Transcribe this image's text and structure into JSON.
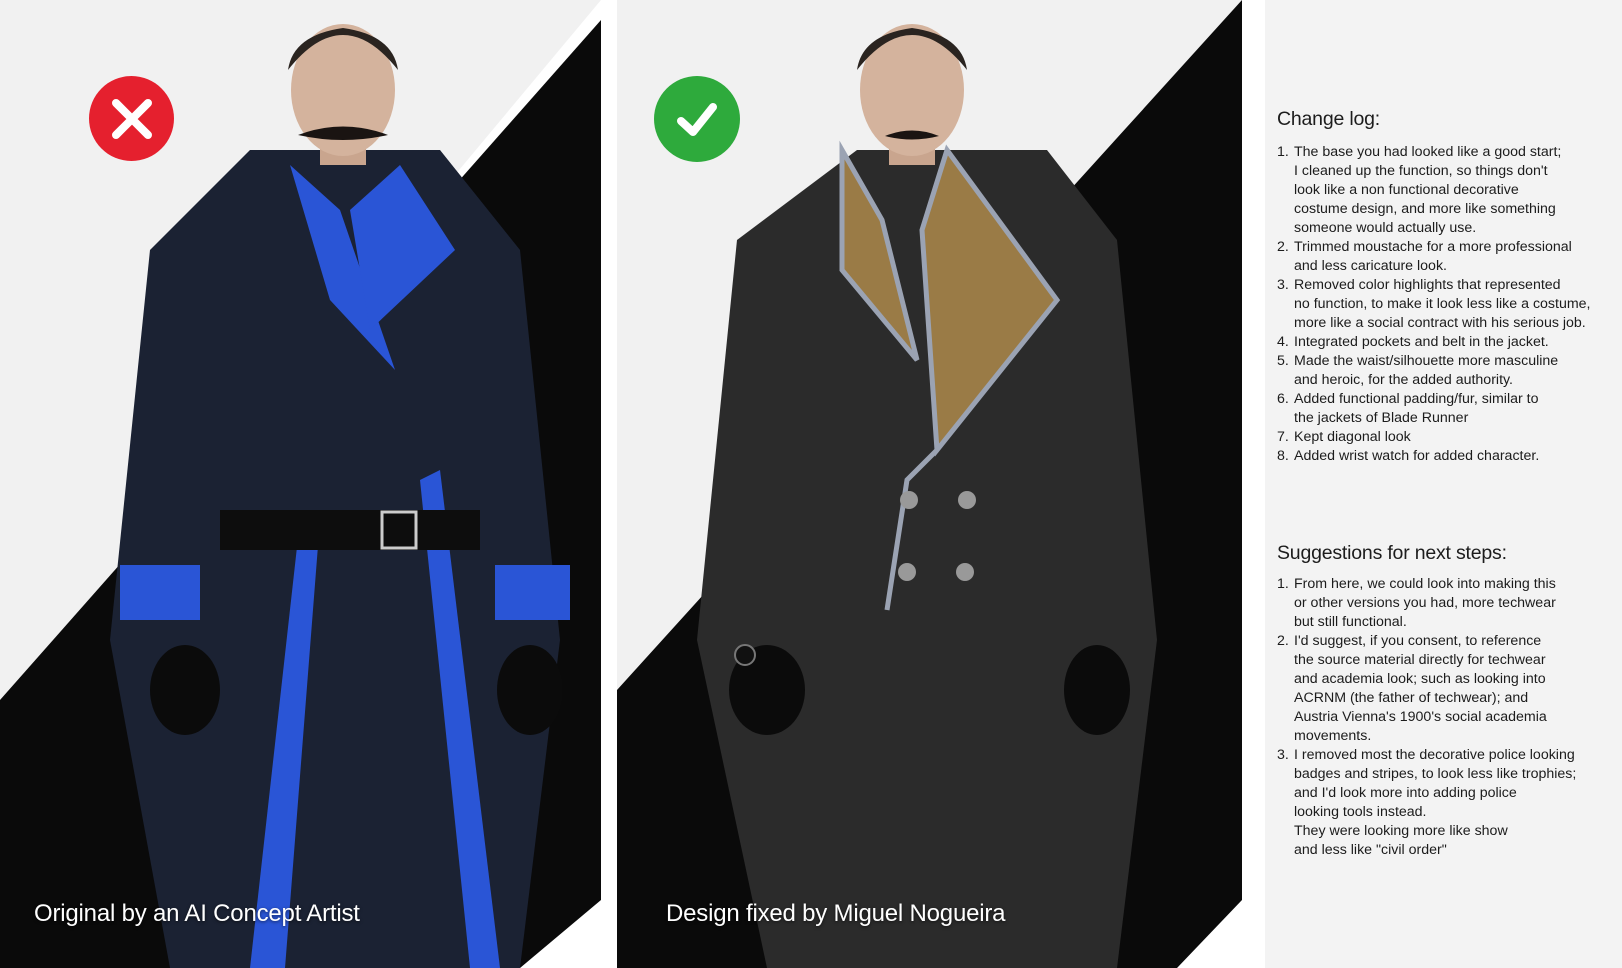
{
  "left_panel": {
    "status": "rejected",
    "status_icon": "x-mark-icon",
    "status_color": "#e5202e",
    "caption": "Original by an AI Concept Artist",
    "accent_color": "#2a55d6"
  },
  "right_panel": {
    "status": "approved",
    "status_icon": "check-mark-icon",
    "status_color": "#2eaa3c",
    "caption": "Design fixed by Miguel Nogueira",
    "accent_color": "#9a7b46"
  },
  "notes": {
    "changelog_title": "Change log:",
    "changelog_items": [
      "The base you had looked like a good start;\nI cleaned up the function, so things don't\nlook like a non functional decorative\ncostume design, and more like something\nsomeone would actually use.",
      "Trimmed moustache for a more professional\nand less caricature look.",
      "Removed color highlights that represented\nno function, to make it look less like a costume,\nmore like a social contract with his serious job.",
      "Integrated pockets and belt in the jacket.",
      "Made the waist/silhouette more masculine\nand heroic, for the added authority.",
      "Added functional padding/fur, similar to\nthe jackets of Blade Runner",
      "Kept diagonal look",
      "Added wrist watch for added character."
    ],
    "suggestions_title": "Suggestions for next steps:",
    "suggestion_items": [
      "From here, we could look into making this\nor other versions you had, more techwear\nbut still functional.",
      "I'd suggest, if you consent, to reference\nthe source material directly for techwear\nand academia look; such as looking into\nACRNM (the father of techwear); and\nAustria Vienna's 1900's social academia\nmovements.",
      "I removed most the decorative police looking\nbadges and stripes, to look less like trophies;\nand I'd look more into adding police\nlooking tools instead.\nThey were looking more like show\nand less like \"civil order\""
    ]
  }
}
